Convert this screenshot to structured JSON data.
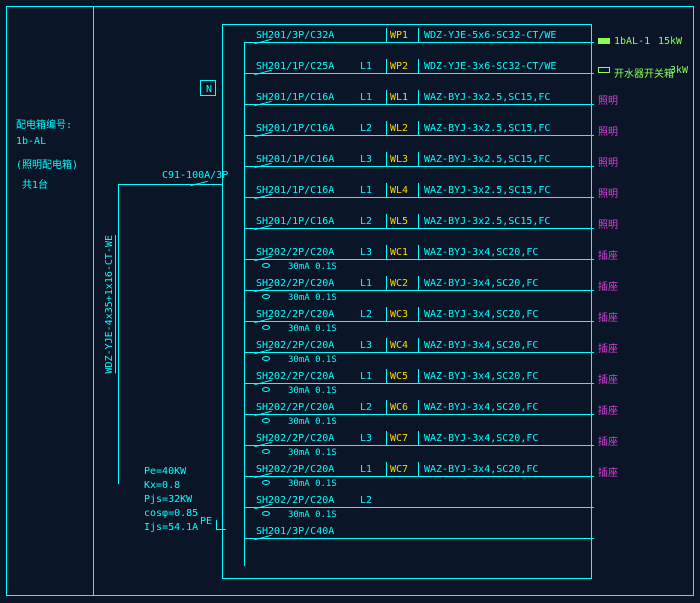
{
  "panel": {
    "label_title": "配电箱编号:",
    "name": "1b-AL",
    "desc": "(照明配电箱)",
    "count": "共1台"
  },
  "main_breaker": "C91-100A/3P",
  "incoming_cable": "WDZ-YJE-4x35+1x16-CT-WE",
  "neutral_label": "N",
  "pe_label": "PE",
  "calc": {
    "pe": "Pe=40KW",
    "kx": "Kx=0.8",
    "pjs": "Pjs=32KW",
    "cos": "cosφ=0.85",
    "ijs": "Ijs=54.1A"
  },
  "outgoing": {
    "right1": {
      "name": "1bAL-1",
      "power": "15kW"
    },
    "right2": {
      "name": "开水器开关箱",
      "power": "3kW"
    }
  },
  "circuits": [
    {
      "brk": "SH201/3P/C32A",
      "phase": "",
      "id": "WP1",
      "cable": "WDZ-YJE-5x6-SC32-CT/WE",
      "load": "",
      "rccb": ""
    },
    {
      "brk": "SH201/1P/C25A",
      "phase": "L1",
      "id": "WP2",
      "cable": "WDZ-YJE-3x6-SC32-CT/WE",
      "load": "",
      "rccb": ""
    },
    {
      "brk": "SH201/1P/C16A",
      "phase": "L1",
      "id": "WL1",
      "cable": "WAZ-BYJ-3x2.5,SC15,FC",
      "load": "照明",
      "rccb": ""
    },
    {
      "brk": "SH201/1P/C16A",
      "phase": "L2",
      "id": "WL2",
      "cable": "WAZ-BYJ-3x2.5,SC15,FC",
      "load": "照明",
      "rccb": ""
    },
    {
      "brk": "SH201/1P/C16A",
      "phase": "L3",
      "id": "WL3",
      "cable": "WAZ-BYJ-3x2.5,SC15,FC",
      "load": "照明",
      "rccb": ""
    },
    {
      "brk": "SH201/1P/C16A",
      "phase": "L1",
      "id": "WL4",
      "cable": "WAZ-BYJ-3x2.5,SC15,FC",
      "load": "照明",
      "rccb": ""
    },
    {
      "brk": "SH201/1P/C16A",
      "phase": "L2",
      "id": "WL5",
      "cable": "WAZ-BYJ-3x2.5,SC15,FC",
      "load": "照明",
      "rccb": ""
    },
    {
      "brk": "SH202/2P/C20A",
      "phase": "L3",
      "id": "WC1",
      "cable": "WAZ-BYJ-3x4,SC20,FC",
      "load": "插座",
      "rccb": "30mA 0.1S"
    },
    {
      "brk": "SH202/2P/C20A",
      "phase": "L1",
      "id": "WC2",
      "cable": "WAZ-BYJ-3x4,SC20,FC",
      "load": "插座",
      "rccb": "30mA 0.1S"
    },
    {
      "brk": "SH202/2P/C20A",
      "phase": "L2",
      "id": "WC3",
      "cable": "WAZ-BYJ-3x4,SC20,FC",
      "load": "插座",
      "rccb": "30mA 0.1S"
    },
    {
      "brk": "SH202/2P/C20A",
      "phase": "L3",
      "id": "WC4",
      "cable": "WAZ-BYJ-3x4,SC20,FC",
      "load": "插座",
      "rccb": "30mA 0.1S"
    },
    {
      "brk": "SH202/2P/C20A",
      "phase": "L1",
      "id": "WC5",
      "cable": "WAZ-BYJ-3x4,SC20,FC",
      "load": "插座",
      "rccb": "30mA 0.1S"
    },
    {
      "brk": "SH202/2P/C20A",
      "phase": "L2",
      "id": "WC6",
      "cable": "WAZ-BYJ-3x4,SC20,FC",
      "load": "插座",
      "rccb": "30mA 0.1S"
    },
    {
      "brk": "SH202/2P/C20A",
      "phase": "L3",
      "id": "WC7",
      "cable": "WAZ-BYJ-3x4,SC20,FC",
      "load": "插座",
      "rccb": "30mA 0.1S"
    },
    {
      "brk": "SH202/2P/C20A",
      "phase": "L1",
      "id": "WC7",
      "cable": "WAZ-BYJ-3x4,SC20,FC",
      "load": "插座",
      "rccb": "30mA 0.1S"
    },
    {
      "brk": "SH202/2P/C20A",
      "phase": "L2",
      "id": "",
      "cable": "",
      "load": "",
      "rccb": "30mA 0.1S"
    },
    {
      "brk": "SH201/3P/C40A",
      "phase": "",
      "id": "",
      "cable": "",
      "load": "",
      "rccb": ""
    }
  ]
}
